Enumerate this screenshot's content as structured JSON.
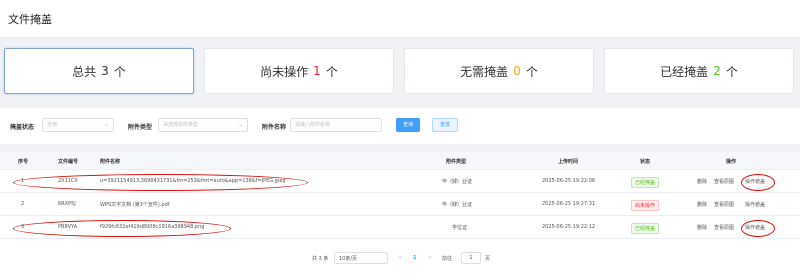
{
  "header": {
    "title": "文件掩盖"
  },
  "cards": [
    {
      "prefix": "总共",
      "num": "3",
      "suffix": "个"
    },
    {
      "prefix": "尚未操作",
      "num": "1",
      "suffix": "个"
    },
    {
      "prefix": "无需掩盖",
      "num": "0",
      "suffix": "个"
    },
    {
      "prefix": "已经掩盖",
      "num": "2",
      "suffix": "个"
    }
  ],
  "filter": {
    "status_label": "掩盖状态",
    "status_value": "全部",
    "type_label": "附件类型",
    "type_placeholder": "请选择附件类型",
    "name_label": "附件名称",
    "name_placeholder": "请输入附件名称",
    "search_button": "查询",
    "reset_button": "重置"
  },
  "table": {
    "headers": [
      "序号",
      "文件编号",
      "附件名称",
      "附件类型",
      "上传时间",
      "状态",
      "操作"
    ],
    "rows": [
      {
        "index": "1",
        "code": "2X11C0",
        "name": "u=3921154913,3698431731&fm=253&fmt=auto&app=138&f=JPEG.jpeg",
        "type": "毕（肄）业证",
        "time": "2025-06-25 19:22:08",
        "status": "已经掩盖",
        "status_color": "green",
        "ops": [
          "删除",
          "查看原图",
          "操作遮盖"
        ]
      },
      {
        "index": "2",
        "code": "6RXP5J",
        "name": "WPS文字文档 (第3个宣件).pdf",
        "type": "毕（肄）业证",
        "time": "2025-06-25 19:27:31",
        "status": "尚未操作",
        "status_color": "red",
        "ops": [
          "删除",
          "查看原图",
          "操作遮盖"
        ]
      },
      {
        "index": "3",
        "code": "PB8VYA",
        "name": "f929fc632ef419d8008c1916a398948.png",
        "type": "学位证",
        "time": "2025-06-25 19:22:12",
        "status": "已经掩盖",
        "status_color": "green",
        "ops": [
          "删除",
          "查看原图",
          "操作遮盖"
        ]
      }
    ]
  },
  "pager": {
    "total": "共 3 条",
    "page_size": "10条/页",
    "prev": "<",
    "page": "1",
    "next": ">",
    "goto_label": "前往",
    "goto_value": "1",
    "page_unit": "页"
  }
}
